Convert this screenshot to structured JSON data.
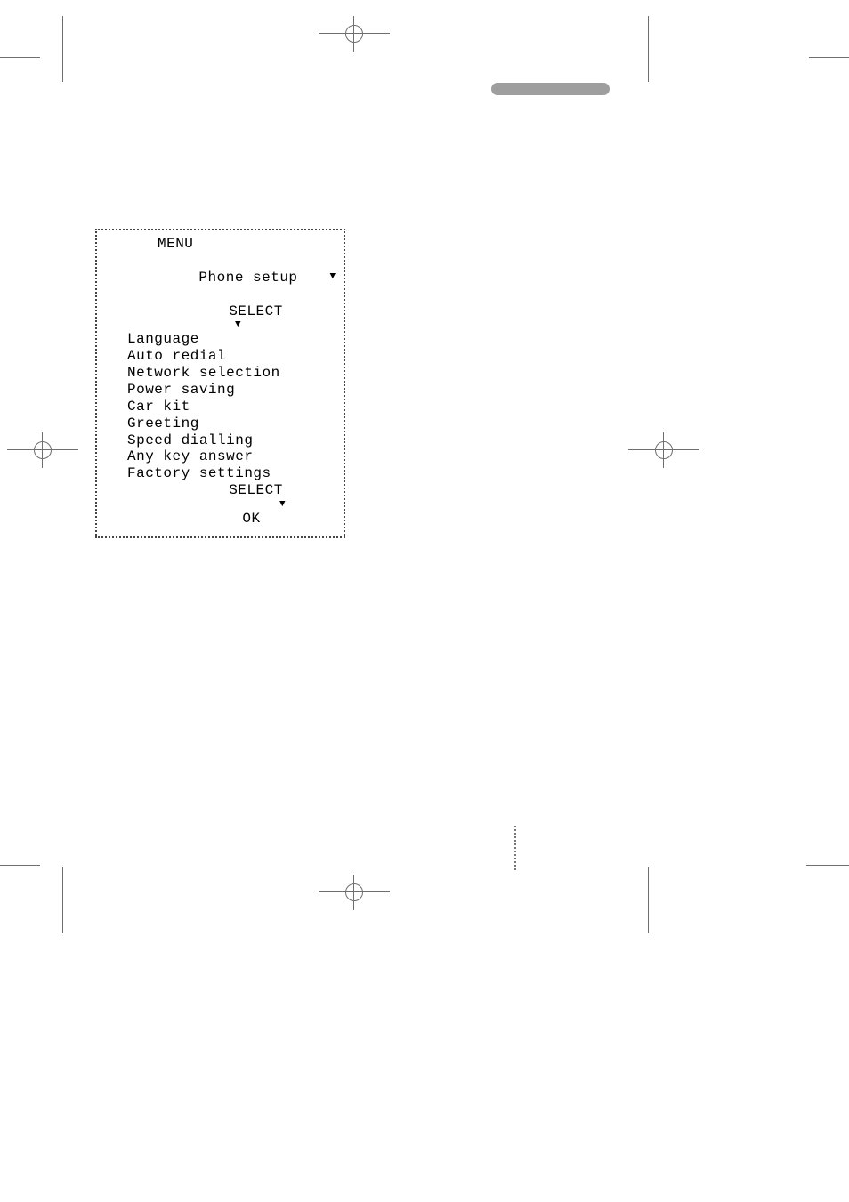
{
  "menu": {
    "title": "MENU",
    "current": "Phone setup",
    "select_label": "SELECT",
    "ok_label": "OK",
    "down_arrow": "▼",
    "items": [
      "Language",
      "Auto redial",
      "Network selection",
      "Power saving",
      "Car kit",
      "Greeting",
      "Speed dialling",
      "Any key answer",
      "Factory settings"
    ]
  }
}
